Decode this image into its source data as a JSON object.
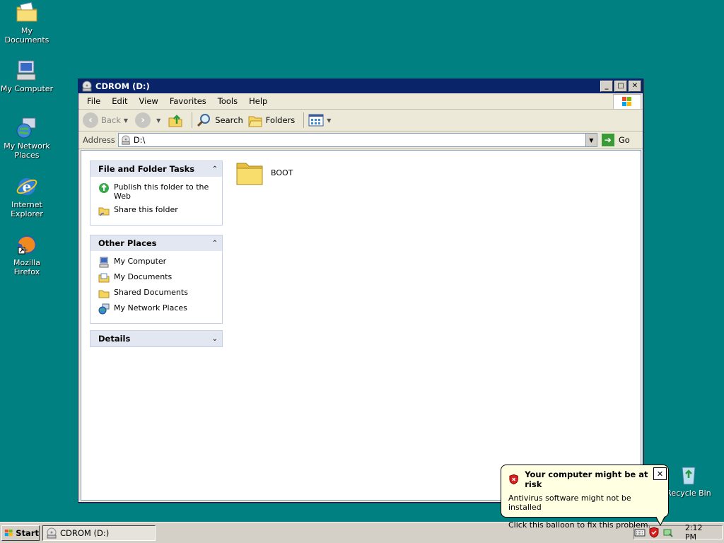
{
  "desktop": {
    "icons": [
      {
        "label": "My Documents"
      },
      {
        "label": "My Computer"
      },
      {
        "label": "My Network Places"
      },
      {
        "label": "Internet Explorer"
      },
      {
        "label": "Mozilla Firefox"
      },
      {
        "label": "Recycle Bin"
      }
    ]
  },
  "window": {
    "title": "CDROM (D:)",
    "menu": [
      "File",
      "Edit",
      "View",
      "Favorites",
      "Tools",
      "Help"
    ],
    "toolbar": {
      "back": "Back",
      "search": "Search",
      "folders": "Folders"
    },
    "address": {
      "label": "Address",
      "value": "D:\\",
      "go": "Go"
    },
    "tasks_panel": {
      "title": "File and Folder Tasks",
      "items": [
        "Publish this folder to the Web",
        "Share this folder"
      ]
    },
    "places_panel": {
      "title": "Other Places",
      "items": [
        "My Computer",
        "My Documents",
        "Shared Documents",
        "My Network Places"
      ]
    },
    "details_panel": {
      "title": "Details"
    },
    "files": [
      {
        "name": "BOOT",
        "type": "folder"
      }
    ]
  },
  "taskbar": {
    "start": "Start",
    "task": "CDROM (D:)",
    "clock": "2:12 PM"
  },
  "balloon": {
    "title": "Your computer might be at risk",
    "line1": "Antivirus software might not be installed",
    "line2": "Click this balloon to fix this problem."
  },
  "colors": {
    "desktop": "#008080",
    "titlebar": "#0a246a",
    "balloon": "#ffffe1"
  }
}
